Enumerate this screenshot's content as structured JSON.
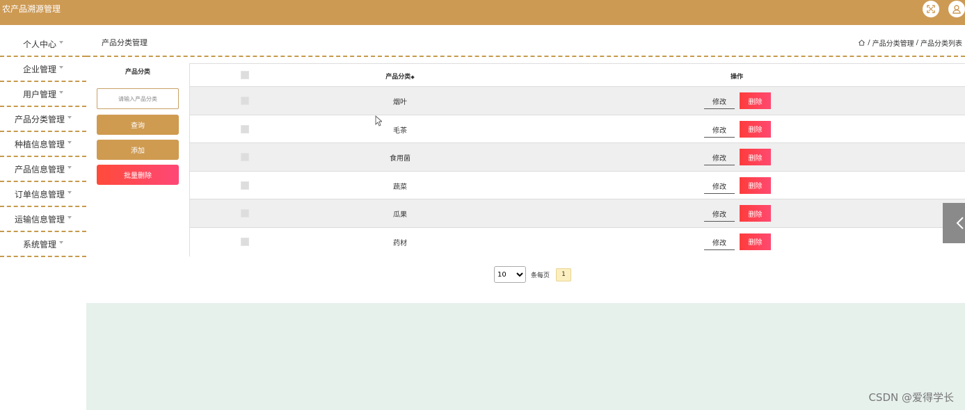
{
  "app": {
    "title": "农产品溯源管理"
  },
  "icons": {
    "fullscreen": "fullscreen-icon",
    "user": "user-icon",
    "home": "home-icon",
    "collapse": "chevron-left-icon"
  },
  "colors": {
    "brand": "#cd9a54",
    "danger": "#ff4455",
    "border_dash": "#c69a4b",
    "bottom_panel": "#e7f1ec"
  },
  "sidebar": {
    "items": [
      {
        "label": "个人中心"
      },
      {
        "label": "企业管理"
      },
      {
        "label": "用户管理"
      },
      {
        "label": "产品分类管理"
      },
      {
        "label": "种植信息管理"
      },
      {
        "label": "产品信息管理"
      },
      {
        "label": "订单信息管理"
      },
      {
        "label": "运输信息管理"
      },
      {
        "label": "系统管理"
      }
    ]
  },
  "header": {
    "page_title": "产品分类管理",
    "breadcrumb": {
      "sep": "/",
      "level1": "产品分类管理",
      "level2": "产品分类列表"
    }
  },
  "filter": {
    "label": "产品分类",
    "placeholder": "请输入产品分类",
    "query_label": "查询",
    "add_label": "添加",
    "batch_delete_label": "批量删除"
  },
  "table": {
    "columns": {
      "name": "产品分类",
      "ops": "操作"
    },
    "sort_symbol": "◆",
    "edit_label": "修改",
    "delete_label": "删除",
    "rows": [
      {
        "name": "烟叶"
      },
      {
        "name": "毛茶"
      },
      {
        "name": "食用菌"
      },
      {
        "name": "蔬菜"
      },
      {
        "name": "瓜果"
      },
      {
        "name": "药材"
      }
    ]
  },
  "pagination": {
    "page_size": "10",
    "per_page_label": "条每页",
    "current_page": "1"
  },
  "watermark": "CSDN @爱得学长"
}
